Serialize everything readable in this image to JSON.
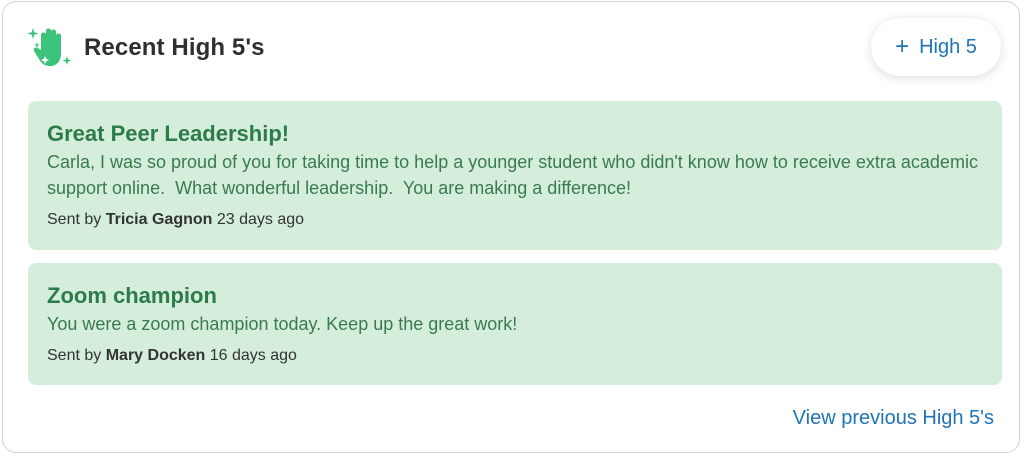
{
  "header": {
    "title": "Recent High 5's",
    "icon": "high-five-hand-icon",
    "icon_color": "#3cc47c",
    "add_button": {
      "icon": "plus-icon",
      "label": "High 5"
    }
  },
  "entries": [
    {
      "title": "Great Peer Leadership!",
      "message": "Carla, I was so proud of you for taking time to help a younger student who didn't know how to receive extra academic support online.  What wonderful leadership.  You are making a difference!",
      "sent_by_label": "Sent by",
      "sender": "Tricia Gagnon",
      "time_ago": "23 days ago"
    },
    {
      "title": "Zoom champion",
      "message": "You were a zoom champion today. Keep up the great work!",
      "sent_by_label": "Sent by",
      "sender": "Mary Docken",
      "time_ago": "16 days ago"
    }
  ],
  "footer": {
    "view_previous_label": "View previous High 5's"
  },
  "colors": {
    "entry_background": "#d5eedb",
    "entry_title": "#2d7a4a",
    "link": "#1f73b7"
  }
}
